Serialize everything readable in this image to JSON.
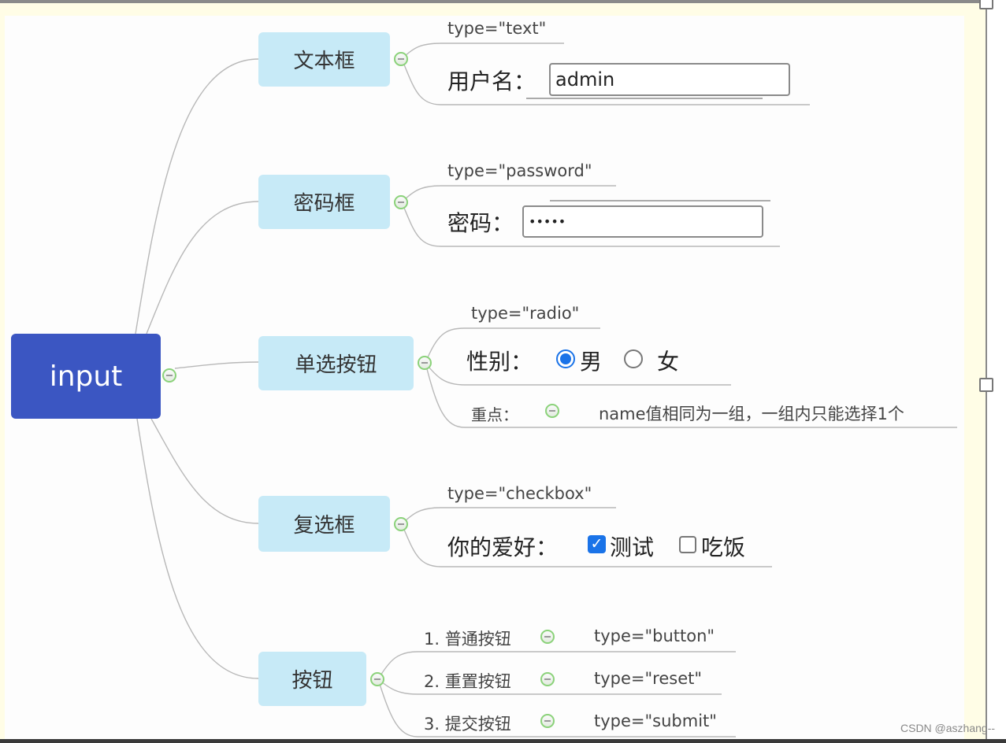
{
  "root": {
    "label": "input"
  },
  "branches": [
    {
      "label": "文本框",
      "type_note": "type=\"text\"",
      "field_label": "用户名：",
      "field_value": "admin"
    },
    {
      "label": "密码框",
      "type_note": "type=\"password\"",
      "field_label": "密码：",
      "field_value": "•••••"
    },
    {
      "label": "单选按钮",
      "type_note": "type=\"radio\"",
      "field_label": "性别：",
      "options": [
        {
          "label": "男",
          "checked": true
        },
        {
          "label": "女",
          "checked": false
        }
      ],
      "key_point_label": "重点：",
      "key_point_text": "name值相同为一组，一组内只能选择1个"
    },
    {
      "label": "复选框",
      "type_note": "type=\"checkbox\"",
      "field_label": "你的爱好：",
      "options": [
        {
          "label": "测试",
          "checked": true,
          "mark": "✓"
        },
        {
          "label": "吃饭",
          "checked": false
        }
      ]
    },
    {
      "label": "按钮",
      "items": [
        {
          "label": "1. 普通按钮",
          "type_note": "type=\"button\""
        },
        {
          "label": "2. 重置按钮",
          "type_note": "type=\"reset\""
        },
        {
          "label": "3. 提交按钮",
          "type_note": "type=\"submit\""
        }
      ]
    }
  ],
  "colors": {
    "root": "#3b56c2",
    "branch": "#c7eaf7",
    "collapse_ring": "#8bd27a",
    "accent": "#1a73e8"
  },
  "watermark": "CSDN @aszhang--"
}
